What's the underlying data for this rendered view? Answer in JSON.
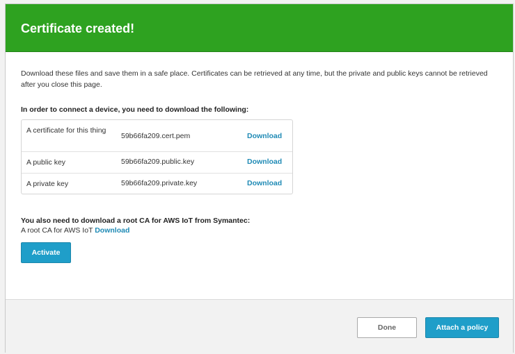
{
  "header": {
    "title": "Certificate created!",
    "color": "#2ea220"
  },
  "intro": "Download these files and save them in a safe place. Certificates can be retrieved at any time, but the private and public keys cannot be retrieved after you close this page.",
  "files_section": {
    "heading": "In order to connect a device, you need to download the following:",
    "rows": [
      {
        "description": "A certificate for this thing",
        "filename": "59b66fa209.cert.pem",
        "action": "Download"
      },
      {
        "description": "A public key",
        "filename": "59b66fa209.public.key",
        "action": "Download"
      },
      {
        "description": "A private key",
        "filename": "59b66fa209.private.key",
        "action": "Download"
      }
    ]
  },
  "root_ca": {
    "heading": "You also need to download a root CA for AWS IoT from Symantec:",
    "label": "A root CA for AWS IoT",
    "link": "Download"
  },
  "buttons": {
    "activate": "Activate",
    "done": "Done",
    "attach_policy": "Attach a policy"
  },
  "colors": {
    "link": "#1f8ab5",
    "primary_button": "#1f9ec9"
  }
}
